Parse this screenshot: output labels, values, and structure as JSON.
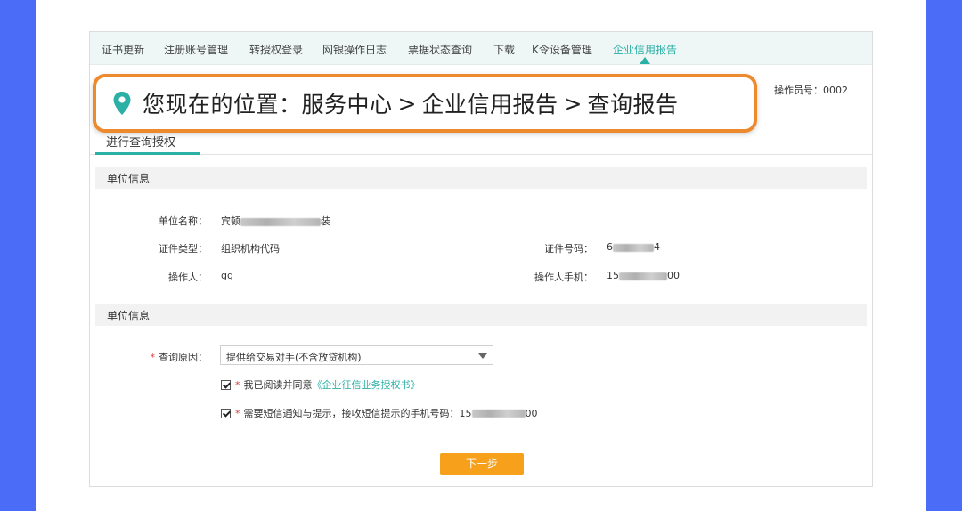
{
  "nav": {
    "items": [
      {
        "label": "证书更新",
        "active": false
      },
      {
        "label": "注册账号管理",
        "active": false
      },
      {
        "label": "转授权登录",
        "active": false
      },
      {
        "label": "网银操作日志",
        "active": false
      },
      {
        "label": "票据状态查询",
        "active": false
      },
      {
        "label": "下载",
        "active": false
      },
      {
        "label": "K令设备管理",
        "active": false
      },
      {
        "label": "企业信用报告",
        "active": true
      }
    ]
  },
  "operator_no": "操作员号：0002",
  "breadcrumb": {
    "prefix": "您现在的位置：",
    "items": [
      "服务中心",
      "企业信用报告",
      "查询报告"
    ],
    "separator": ">"
  },
  "tab": {
    "label": "进行查询授权"
  },
  "section1": {
    "title": "单位信息",
    "unit_name_label": "单位名称：",
    "unit_name_prefix": "宾顿",
    "unit_name_suffix": "装",
    "cert_type_label": "证件类型：",
    "cert_type_value": "组织机构代码",
    "cert_no_label": "证件号码：",
    "cert_no_prefix": "6",
    "cert_no_suffix": "4",
    "operator_label": "操作人：",
    "operator_value": "gg",
    "operator_phone_label": "操作人手机：",
    "operator_phone_prefix": "15",
    "operator_phone_suffix": "00"
  },
  "section2": {
    "title": "单位信息",
    "query_reason_label": "查询原因：",
    "query_reason_value": "提供给交易对手(不含放贷机构)",
    "agree_text": "我已阅读并同意",
    "agree_link": "《企业征信业务授权书》",
    "sms_text": "需要短信通知与提示，接收短信提示的手机号码：15",
    "sms_suffix": "00",
    "next_button": "下一步"
  },
  "colors": {
    "accent": "#2bb0a6",
    "highlight_border": "#ee8a2e",
    "button": "#f7a01c",
    "frame": "#4a6cf7"
  }
}
